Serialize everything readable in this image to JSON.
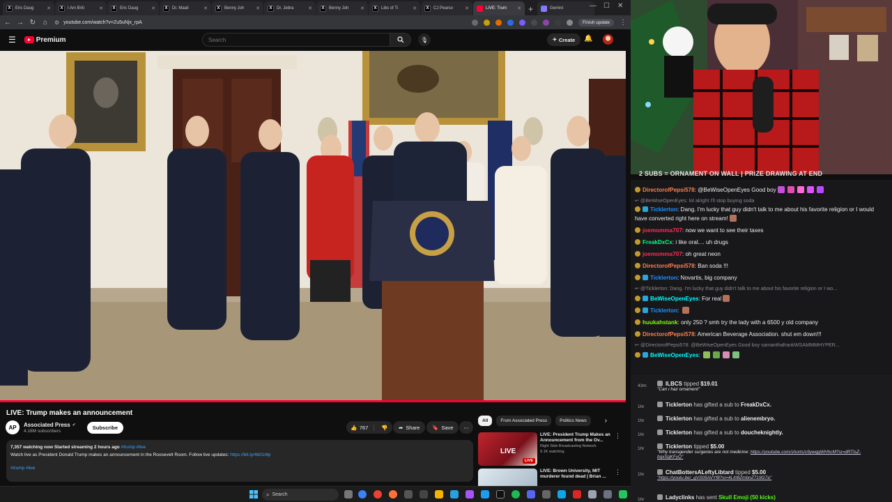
{
  "browser": {
    "tabs": [
      {
        "label": "Eric Daug",
        "icon": "x"
      },
      {
        "label": "I Am Briti",
        "icon": "x"
      },
      {
        "label": "Eric Daug",
        "icon": "x"
      },
      {
        "label": "Dr. Maali",
        "icon": "x"
      },
      {
        "label": "Benny Joh",
        "icon": "x"
      },
      {
        "label": "Dr. Jebra",
        "icon": "x"
      },
      {
        "label": "Benny Joh",
        "icon": "x"
      },
      {
        "label": "Libs of Ti",
        "icon": "x"
      },
      {
        "label": "CJ Pearso",
        "icon": "x"
      },
      {
        "label": "LIVE: Trum",
        "icon": "yt",
        "active": true
      },
      {
        "label": "Gemini",
        "icon": "gm"
      }
    ],
    "url": "youtube.com/watch?v=Zu5uNjx_rpA",
    "finish_update": "Finish update"
  },
  "youtube": {
    "logo_text": "Premium",
    "search_placeholder": "Search",
    "create_label": "Create",
    "video_title": "LIVE: Trump makes an announcement",
    "channel_name": "Associated Press",
    "channel_avatar": "AP",
    "subscribers": "4.18M subscribers",
    "subscribe_label": "Subscribe",
    "like_count": "767",
    "share_label": "Share",
    "save_label": "Save",
    "progress": 0.999,
    "description": {
      "stats": "7,357 watching now  Started streaming 2 hours ago",
      "tags_inline": "#trump #live",
      "text": "Watch live as President Donald Trump makes an announcement in the Roosevelt Room. Follow live updates:",
      "link": "https://bit.ly/4b01t4p",
      "tags_bottom": "#trump #live"
    },
    "chips": [
      "All",
      "From Associated Press",
      "Politics News"
    ],
    "related": [
      {
        "title": "LIVE: President Trump Makes an Announcement from the Ov...",
        "channel": "Right Side Broadcasting Network",
        "meta": "9.1K watching",
        "badge": "LIVE",
        "overlay": "LIVE"
      },
      {
        "title": "LIVE: Brown University, MIT murderer found dead | Brian ...",
        "channel": "",
        "meta": "",
        "badge": ""
      }
    ]
  },
  "taskbar": {
    "search_label": "Search"
  },
  "stream": {
    "banner": "2 SUBS = ORNAMENT ON WALL | PRIZE DRAWING AT END"
  },
  "chat": [
    {
      "user": "DirectorofPepsi578",
      "color": "#ff7f50",
      "text": "@BeWiseOpenEyes Good boy",
      "type": "msg"
    },
    {
      "user": "",
      "text": "@BeWiseOpenEyes: lol alright I'll stop buying soda",
      "type": "reply"
    },
    {
      "user": "Ticklerton",
      "color": "#1e90ff",
      "text": "Dang. I'm lucky that guy didn't talk to me about his favorite religion or I would have converted right here on stream!",
      "type": "wrap"
    },
    {
      "user": "joemomma707",
      "color": "#ff2d55",
      "text": "now we want to see their taxes",
      "type": "msg"
    },
    {
      "user": "FreakDxCx",
      "color": "#00ff7f",
      "text": "i like oral.... uh drugs",
      "type": "msg"
    },
    {
      "user": "joemomma707",
      "color": "#ff2d55",
      "text": "oh great neon",
      "type": "msg"
    },
    {
      "user": "DirectorofPepsi578",
      "color": "#ff7f50",
      "text": "Ban soda !!!",
      "type": "msg"
    },
    {
      "user": "Ticklerton",
      "color": "#1e90ff",
      "text": "Novartis, big company",
      "type": "msg"
    },
    {
      "user": "",
      "text": "@Ticklerton: Dang. I'm lucky that guy didn't talk to me about his favorite religion or I wo...",
      "type": "reply"
    },
    {
      "user": "BeWiseOpenEyes",
      "color": "#00ffff",
      "text": "For real",
      "type": "msg"
    },
    {
      "user": "Ticklerton",
      "color": "#1e90ff",
      "text": "",
      "type": "msg"
    },
    {
      "user": "huukahstank",
      "color": "#7fff00",
      "text": "only 250 ? smh try the lady with a 6500 y old company",
      "type": "msg"
    },
    {
      "user": "DirectorofPepsi578",
      "color": "#ff7f50",
      "text": "American Beverage Association. shut em down!!!",
      "type": "msg"
    },
    {
      "user": "",
      "text": "@DirectorofPepsi578: @BeWiseOpenEyes Good boy samanthafrankWSAMMMHYPER...",
      "type": "reply"
    },
    {
      "user": "BeWiseOpenEyes",
      "color": "#00ffff",
      "text": "",
      "type": "msg"
    }
  ],
  "events": [
    {
      "time": "43m",
      "name": "ILBCS",
      "action": "tipped",
      "amount": "$19.01",
      "msg": "\"Can i haz ornament\""
    },
    {
      "time": "1hr",
      "name": "Ticklerton",
      "action": "has gifted a sub to",
      "target": "FreakDxCx."
    },
    {
      "time": "1hr",
      "name": "Ticklerton",
      "action": "has gifted a sub to",
      "target": "alienembryo."
    },
    {
      "time": "1hr",
      "name": "Ticklerton",
      "action": "has gifted a sub to",
      "target": "doucheknightly."
    },
    {
      "time": "1hr",
      "name": "Ticklerton",
      "action": "tipped",
      "amount": "$5.00",
      "msg": "\"Why transgender surgeries are not medicine:",
      "link": "https://youtube.com/shorts/v9ywqgWHhcM?si=dRTlsZ-bqxSgKFyQ\""
    },
    {
      "time": "1hr",
      "name": "ChatBottersALeftyLibtard",
      "action": "tipped",
      "amount": "$5.00",
      "link": "\"https://youtu.be/_gVS05AVYf8?si=4LI08ZmbnZ719G7a\""
    },
    {
      "time": "1hr",
      "name": "Ladyclinks",
      "action": "has sent",
      "amount": "Skull Emoji (50 kicks)"
    }
  ]
}
